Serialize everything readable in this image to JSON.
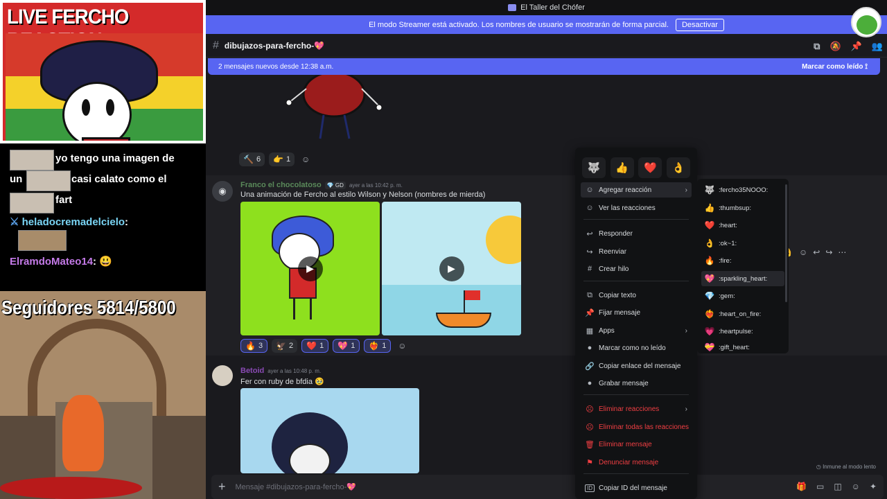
{
  "stream": {
    "title": "LIVE FERCHO REACTION",
    "chat": {
      "line0": "yo tengo una imagen de",
      "line1_a": "un",
      "line1_b": "casi calato como el",
      "line2": "fart",
      "user1": "heladocremadelcielo",
      "user1_suffix": ":",
      "user2": "ElramdoMateo14",
      "user2_suffix": ":"
    },
    "followers": "Seguidores 5814/5800"
  },
  "window": {
    "title": "El Taller del Chófer"
  },
  "streamer_bar": {
    "text": "El modo Streamer está activado. Los nombres de usuario se mostrarán de forma parcial.",
    "button": "Desactivar"
  },
  "channel": {
    "name": "dibujazos-para-fercho-💖"
  },
  "new_messages": {
    "text": "2 mensajes nuevos desde 12:38 a.m.",
    "mark_read": "Marcar como leído"
  },
  "reactions_top": [
    {
      "emoji": "🔨",
      "count": "6"
    },
    {
      "emoji": "👉",
      "count": "1"
    }
  ],
  "message1": {
    "author": "Franco el chocolatoso",
    "tag": "💎 GD",
    "timestamp": "ayer a las 10:42 p. m.",
    "text": "Una animación de Fercho al estilo Wilson y Nelson (nombres de mierda)",
    "reactions": [
      {
        "emoji": "🔥",
        "count": "3"
      },
      {
        "emoji": "🦅",
        "count": "2"
      },
      {
        "emoji": "❤️",
        "count": "1"
      },
      {
        "emoji": "💖",
        "count": "1"
      },
      {
        "emoji": "❤️‍🔥",
        "count": "1"
      }
    ]
  },
  "message2": {
    "author": "Betoid",
    "timestamp": "ayer a las 10:48 p. m.",
    "text": "Fer con ruby de bfdia 🥹"
  },
  "input": {
    "placeholder": "Mensaje #dibujazos-para-fercho-💖"
  },
  "slowmode": "Inmune al modo lento",
  "context_menu": {
    "quick_reactions": [
      "🐺",
      "👍",
      "❤️",
      "👌"
    ],
    "items": [
      {
        "label": "Agregar reacción",
        "icon": "☺",
        "arrow": "›"
      },
      {
        "label": "Ver las reacciones",
        "icon": "☺"
      },
      {
        "label": "Responder",
        "icon": "↩"
      },
      {
        "label": "Reenviar",
        "icon": "↪"
      },
      {
        "label": "Crear hilo",
        "icon": "#"
      },
      {
        "label": "Copiar texto",
        "icon": "⧉"
      },
      {
        "label": "Fijar mensaje",
        "icon": "📌"
      },
      {
        "label": "Apps",
        "icon": "▦",
        "arrow": "›"
      },
      {
        "label": "Marcar como no leído",
        "icon": "●"
      },
      {
        "label": "Copiar enlace del mensaje",
        "icon": "🔗"
      },
      {
        "label": "Grabar mensaje",
        "icon": "●"
      },
      {
        "label": "Eliminar reacciones",
        "icon": "☹",
        "arrow": "›"
      },
      {
        "label": "Eliminar todas las reacciones",
        "icon": "☹"
      },
      {
        "label": "Eliminar mensaje",
        "icon": "🗑"
      },
      {
        "label": "Denunciar mensaje",
        "icon": "⚑"
      },
      {
        "label": "Copiar ID del mensaje",
        "icon": "ID"
      }
    ]
  },
  "emoji_submenu": [
    {
      "emoji": "🐺",
      "label": ":fercho35NOOO:"
    },
    {
      "emoji": "👍",
      "label": ":thumbsup:"
    },
    {
      "emoji": "❤️",
      "label": ":heart:"
    },
    {
      "emoji": "👌",
      "label": ":ok~1:"
    },
    {
      "emoji": "🔥",
      "label": ":fire:"
    },
    {
      "emoji": "💖",
      "label": ":sparkling_heart:"
    },
    {
      "emoji": "💎",
      "label": ":gem:"
    },
    {
      "emoji": "❤️‍🔥",
      "label": ":heart_on_fire:"
    },
    {
      "emoji": "💗",
      "label": ":heartpulse:"
    },
    {
      "emoji": "💝",
      "label": ":gift_heart:"
    }
  ],
  "colors": {
    "blurple": "#5865f2",
    "danger": "#f23f43",
    "bg": "#1a1a1e"
  }
}
